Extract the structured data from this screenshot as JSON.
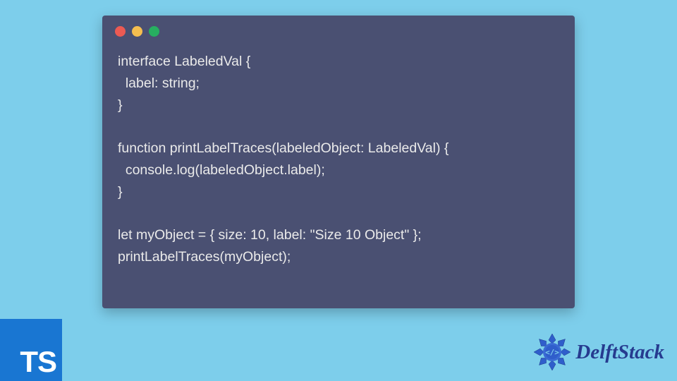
{
  "window_controls": {
    "colors": [
      "#ec5a53",
      "#f5be4f",
      "#27ae60"
    ]
  },
  "code": {
    "lines": [
      "interface LabeledVal {",
      "  label: string;",
      "}",
      "",
      "function printLabelTraces(labeledObject: LabeledVal) {",
      "  console.log(labeledObject.label);",
      "}",
      "",
      "let myObject = { size: 10, label: \"Size 10 Object\" };",
      "printLabelTraces(myObject);"
    ]
  },
  "ts_badge": {
    "label": "TS"
  },
  "brand": {
    "name": "DelftStack"
  },
  "colors": {
    "page_bg": "#7dceeb",
    "code_bg": "#4a5072",
    "code_fg": "#eaeaea",
    "ts_bg": "#1976d2",
    "brand_fg": "#263b8f"
  }
}
